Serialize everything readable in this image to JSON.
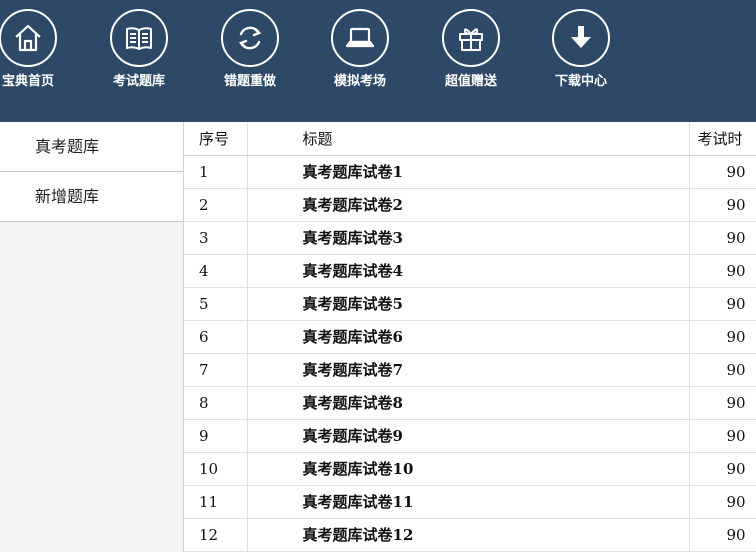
{
  "toolbar": {
    "items": [
      {
        "label": "宝典首页",
        "icon": "home-icon"
      },
      {
        "label": "考试题库",
        "icon": "book-icon"
      },
      {
        "label": "错题重做",
        "icon": "refresh-icon"
      },
      {
        "label": "模拟考场",
        "icon": "laptop-icon"
      },
      {
        "label": "超值赠送",
        "icon": "gift-icon"
      },
      {
        "label": "下载中心",
        "icon": "download-icon"
      }
    ],
    "background": "#2e4868"
  },
  "sidebar": {
    "items": [
      {
        "label": "真考题库"
      },
      {
        "label": "新增题库"
      }
    ]
  },
  "table": {
    "headers": {
      "no": "序号",
      "title": "标题",
      "time": "考试时"
    },
    "rows": [
      {
        "no": "1",
        "title": "真考题库试卷1",
        "time": "90"
      },
      {
        "no": "2",
        "title": "真考题库试卷2",
        "time": "90"
      },
      {
        "no": "3",
        "title": "真考题库试卷3",
        "time": "90"
      },
      {
        "no": "4",
        "title": "真考题库试卷4",
        "time": "90"
      },
      {
        "no": "5",
        "title": "真考题库试卷5",
        "time": "90"
      },
      {
        "no": "6",
        "title": "真考题库试卷6",
        "time": "90"
      },
      {
        "no": "7",
        "title": "真考题库试卷7",
        "time": "90"
      },
      {
        "no": "8",
        "title": "真考题库试卷8",
        "time": "90"
      },
      {
        "no": "9",
        "title": "真考题库试卷9",
        "time": "90"
      },
      {
        "no": "10",
        "title": "真考题库试卷10",
        "time": "90"
      },
      {
        "no": "11",
        "title": "真考题库试卷11",
        "time": "90"
      },
      {
        "no": "12",
        "title": "真考题库试卷12",
        "time": "90"
      }
    ]
  }
}
